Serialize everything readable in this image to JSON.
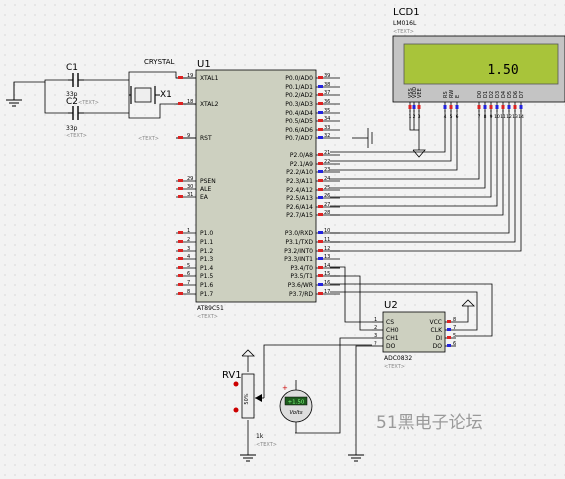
{
  "lcd": {
    "ref": "LCD1",
    "part": "LM016L",
    "text_tag": "<TEXT>",
    "display_value": "1.50",
    "pins": [
      {
        "label": "VSS",
        "num": "1"
      },
      {
        "label": "VDD",
        "num": "2"
      },
      {
        "label": "VEE",
        "num": "3"
      },
      {
        "label": "RS",
        "num": "4"
      },
      {
        "label": "RW",
        "num": "5"
      },
      {
        "label": "E",
        "num": "6"
      },
      {
        "label": "D0",
        "num": "7"
      },
      {
        "label": "D1",
        "num": "8"
      },
      {
        "label": "D2",
        "num": "9"
      },
      {
        "label": "D3",
        "num": "10"
      },
      {
        "label": "D4",
        "num": "11"
      },
      {
        "label": "D5",
        "num": "12"
      },
      {
        "label": "D6",
        "num": "13"
      },
      {
        "label": "D7",
        "num": "14"
      }
    ]
  },
  "mcu": {
    "ref": "U1",
    "part": "AT89C51",
    "text_tag": "<TEXT>",
    "left_pins": [
      {
        "label": "XTAL1",
        "num": "19"
      },
      {
        "label": "XTAL2",
        "num": "18"
      },
      {
        "label": "RST",
        "num": "9"
      },
      {
        "label": "PSEN",
        "num": "29"
      },
      {
        "label": "ALE",
        "num": "30"
      },
      {
        "label": "EA",
        "num": "31"
      },
      {
        "label": "P1.0",
        "num": "1"
      },
      {
        "label": "P1.1",
        "num": "2"
      },
      {
        "label": "P1.2",
        "num": "3"
      },
      {
        "label": "P1.3",
        "num": "4"
      },
      {
        "label": "P1.4",
        "num": "5"
      },
      {
        "label": "P1.5",
        "num": "6"
      },
      {
        "label": "P1.6",
        "num": "7"
      },
      {
        "label": "P1.7",
        "num": "8"
      }
    ],
    "right_pins": [
      {
        "label": "P0.0/AD0",
        "num": "39"
      },
      {
        "label": "P0.1/AD1",
        "num": "38"
      },
      {
        "label": "P0.2/AD2",
        "num": "37"
      },
      {
        "label": "P0.3/AD3",
        "num": "36"
      },
      {
        "label": "P0.4/AD4",
        "num": "35"
      },
      {
        "label": "P0.5/AD5",
        "num": "34"
      },
      {
        "label": "P0.6/AD6",
        "num": "33"
      },
      {
        "label": "P0.7/AD7",
        "num": "32"
      },
      {
        "label": "P2.0/A8",
        "num": "21"
      },
      {
        "label": "P2.1/A9",
        "num": "22"
      },
      {
        "label": "P2.2/A10",
        "num": "23"
      },
      {
        "label": "P2.3/A11",
        "num": "24"
      },
      {
        "label": "P2.4/A12",
        "num": "25"
      },
      {
        "label": "P2.5/A13",
        "num": "26"
      },
      {
        "label": "P2.6/A14",
        "num": "27"
      },
      {
        "label": "P2.7/A15",
        "num": "28"
      },
      {
        "label": "P3.0/RXD",
        "num": "10"
      },
      {
        "label": "P3.1/TXD",
        "num": "11"
      },
      {
        "label": "P3.2/INT0",
        "num": "12"
      },
      {
        "label": "P3.3/INT1",
        "num": "13"
      },
      {
        "label": "P3.4/T0",
        "num": "14"
      },
      {
        "label": "P3.5/T1",
        "num": "15"
      },
      {
        "label": "P3.6/WR",
        "num": "16"
      },
      {
        "label": "P3.7/RD",
        "num": "17"
      }
    ]
  },
  "crystal": {
    "ref": "X1",
    "part": "CRYSTAL",
    "text_tag": "<TEXT>"
  },
  "c1": {
    "ref": "C1",
    "value": "33p",
    "text_tag": "<TEXT>"
  },
  "c2": {
    "ref": "C2",
    "value": "33p",
    "text_tag": "<TEXT>"
  },
  "adc": {
    "ref": "U2",
    "part": "ADC0832",
    "text_tag": "<TEXT>",
    "left_pins": [
      {
        "label": "CS",
        "num": "1"
      },
      {
        "label": "CH0",
        "num": "2"
      },
      {
        "label": "CH1",
        "num": "3"
      },
      {
        "label": "DO",
        "num": "?"
      }
    ],
    "right_pins": [
      {
        "label": "VCC",
        "num": "8"
      },
      {
        "label": "CLK",
        "num": "7"
      },
      {
        "label": "DI",
        "num": "5"
      },
      {
        "label": "DO",
        "num": "6"
      }
    ]
  },
  "pot": {
    "ref": "RV1",
    "value": "1k",
    "text_tag": "<TEXT>",
    "percent": "50%"
  },
  "voltmeter": {
    "reading": "+1.50",
    "unit": "Volts"
  },
  "watermark": "51黑电子论坛"
}
